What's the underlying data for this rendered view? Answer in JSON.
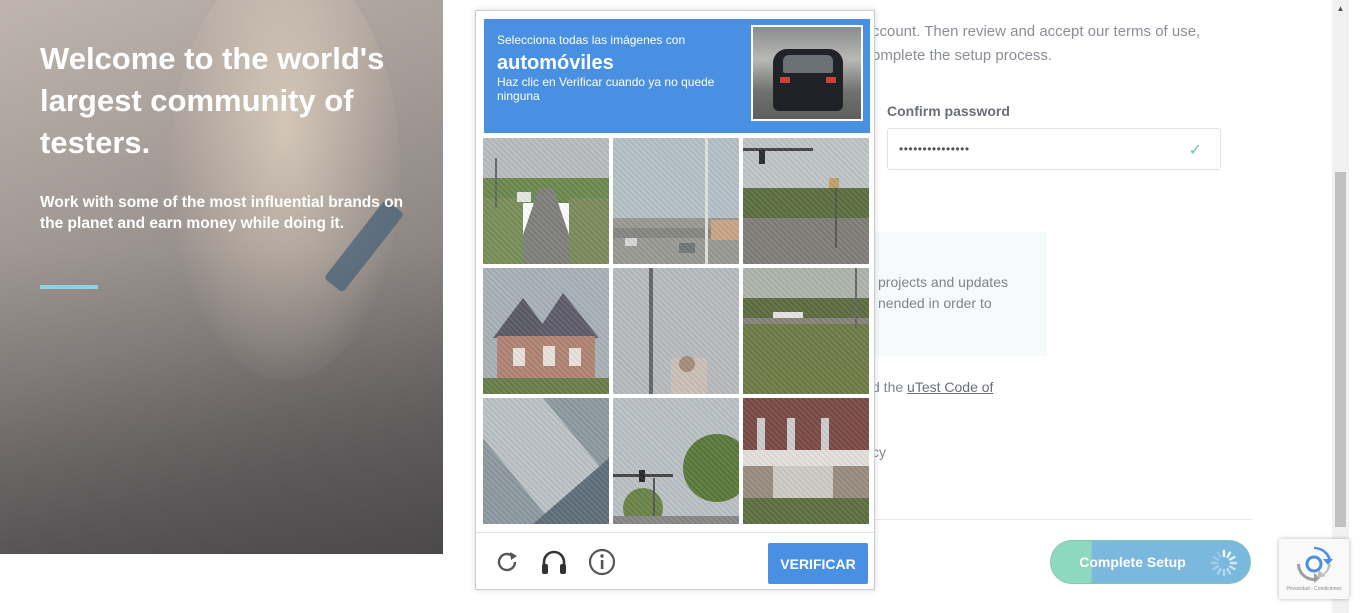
{
  "hero": {
    "title": "Welcome to the world's largest community of testers.",
    "subtitle": "Work with some of the most influential brands on the planet and earn money while doing it."
  },
  "form": {
    "intro_line1": "ccount. Then review and accept our terms of use,",
    "intro_line2": "omplete the setup process.",
    "confirm_label": "Confirm password",
    "confirm_value": "•••••••••••••••",
    "info_text": "projects and updates nended in order to",
    "terms_prefix": "d the ",
    "terms_link": "uTest Code of",
    "policy_text": "cy",
    "complete_label": "Complete Setup"
  },
  "captcha": {
    "instruction": "Selecciona todas las imágenes con",
    "keyword": "automóviles",
    "subinstruction": "Haz clic en Verificar cuando ya no quede ninguna",
    "verify_label": "VERIFICAR",
    "tiles": [
      {
        "id": 1,
        "desc": "road-with-car"
      },
      {
        "id": 2,
        "desc": "street-with-cars"
      },
      {
        "id": 3,
        "desc": "intersection-traffic-light"
      },
      {
        "id": 4,
        "desc": "brick-house"
      },
      {
        "id": 5,
        "desc": "pole-sky"
      },
      {
        "id": 6,
        "desc": "field-with-car"
      },
      {
        "id": 7,
        "desc": "blurred-road"
      },
      {
        "id": 8,
        "desc": "traffic-light-trees"
      },
      {
        "id": 9,
        "desc": "house-porch"
      }
    ]
  },
  "badge": {
    "legal": "Privacidad - Condiciones"
  },
  "colors": {
    "captcha_blue": "#4a90e2",
    "accent_cyan": "#8fd0e6",
    "success_green": "#6cc4a3"
  }
}
